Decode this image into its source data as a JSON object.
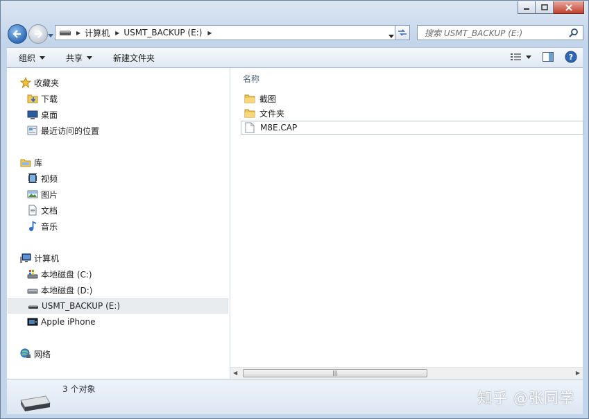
{
  "window": {
    "caption_buttons": [
      "minimize",
      "maximize",
      "close"
    ]
  },
  "navigation": {
    "address_crumbs": [
      "计算机",
      "USMT_BACKUP (E:)"
    ],
    "search_placeholder": "搜索 USMT_BACKUP (E:)"
  },
  "toolbar": {
    "organize_label": "组织",
    "share_label": "共享",
    "new_folder_label": "新建文件夹"
  },
  "sidebar": {
    "favorites": {
      "label": "收藏夹",
      "items": [
        {
          "label": "下载",
          "icon": "downloads-icon"
        },
        {
          "label": "桌面",
          "icon": "desktop-icon"
        },
        {
          "label": "最近访问的位置",
          "icon": "recent-places-icon"
        }
      ]
    },
    "libraries": {
      "label": "库",
      "items": [
        {
          "label": "视频",
          "icon": "videos-icon"
        },
        {
          "label": "图片",
          "icon": "pictures-icon"
        },
        {
          "label": "文档",
          "icon": "documents-icon"
        },
        {
          "label": "音乐",
          "icon": "music-icon"
        }
      ]
    },
    "computer": {
      "label": "计算机",
      "items": [
        {
          "label": "本地磁盘 (C:)",
          "icon": "local-disk-c-icon"
        },
        {
          "label": "本地磁盘 (D:)",
          "icon": "local-disk-d-icon"
        },
        {
          "label": "USMT_BACKUP (E:)",
          "icon": "usb-drive-icon",
          "selected": true
        },
        {
          "label": "Apple iPhone",
          "icon": "iphone-icon"
        }
      ]
    },
    "network": {
      "label": "网络"
    }
  },
  "content": {
    "column_header": "名称",
    "files": [
      {
        "name": "截图",
        "type": "folder"
      },
      {
        "name": "文件夹",
        "type": "folder"
      },
      {
        "name": "M8E.CAP",
        "type": "file"
      }
    ]
  },
  "status": {
    "count_text": "3 个对象"
  },
  "watermark": "知乎 @张同学"
}
